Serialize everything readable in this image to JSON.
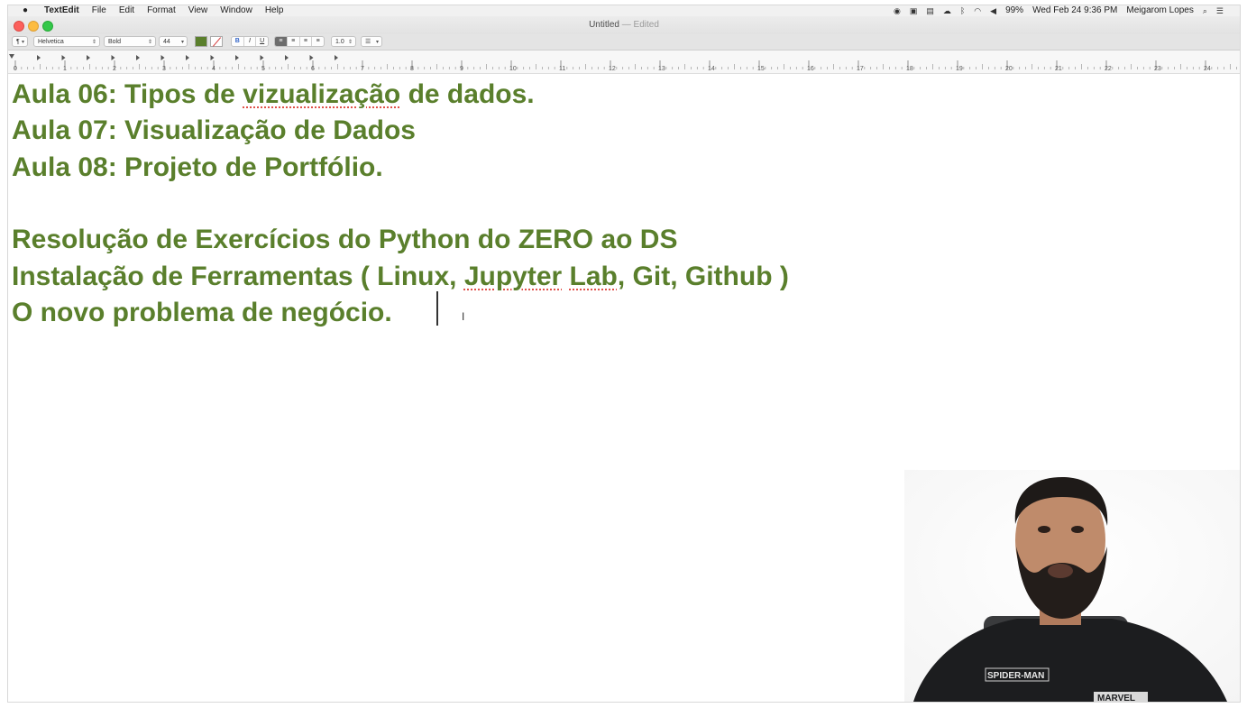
{
  "menubar": {
    "app_name": "TextEdit",
    "items": [
      "File",
      "Edit",
      "Format",
      "View",
      "Window",
      "Help"
    ],
    "battery": "99%",
    "datetime": "Wed Feb 24  9:36 PM",
    "user": "Meigarom Lopes"
  },
  "window": {
    "title": "Untitled",
    "title_suffix": "— Edited"
  },
  "toolbar": {
    "paragraph_style": "¶",
    "font_family": "Helvetica",
    "font_style": "Bold",
    "font_size": "44",
    "bold_label": "B",
    "italic_label": "I",
    "underline_label": "U",
    "line_spacing": "1.0",
    "text_color": "#5a7f2c"
  },
  "ruler": {
    "labels": [
      "0",
      "1",
      "2",
      "3",
      "4",
      "5",
      "6",
      "7",
      "8",
      "9",
      "10",
      "11",
      "12",
      "13",
      "14",
      "15",
      "16",
      "17",
      "18",
      "19",
      "20",
      "21",
      "22",
      "23",
      "24"
    ]
  },
  "document": {
    "lines": [
      {
        "parts": [
          "Aula 06: Tipos de ",
          "vizualização",
          " de dados."
        ]
      },
      {
        "text": "Aula 07: Visualização de Dados"
      },
      {
        "text": "Aula 08: Projeto de Portfólio."
      },
      {
        "text": ""
      },
      {
        "text": "Resolução de Exercícios do Python do ZERO ao DS"
      },
      {
        "parts": [
          "Instalação de Ferramentas ( Linux, ",
          "Jupyter",
          " ",
          "Lab",
          ", Git, Github )"
        ]
      },
      {
        "text": "O novo problema de negócio."
      }
    ],
    "color": "#5a7f2c"
  },
  "webcam": {
    "shirt_text_1": "SPIDER-MAN",
    "shirt_text_2": "MARVEL"
  }
}
